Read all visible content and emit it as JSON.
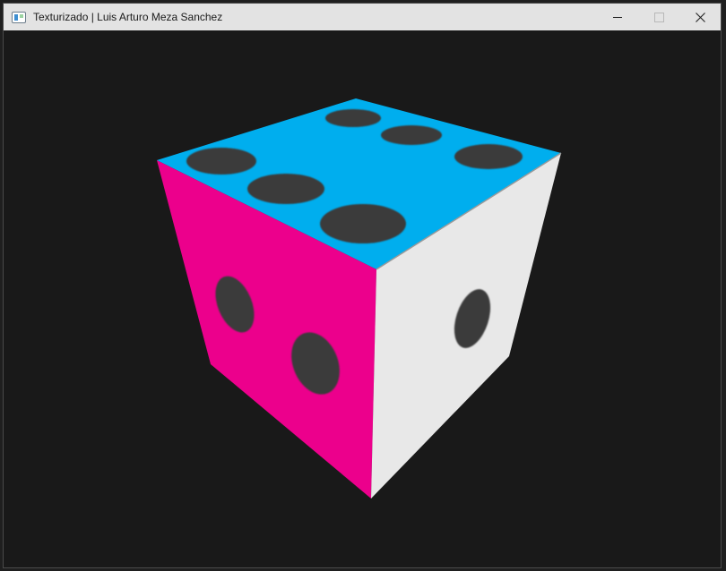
{
  "window": {
    "title": "Texturizado | Luis Arturo Meza Sanchez"
  },
  "scene": {
    "object": "dice cube",
    "top_face_pips": 6,
    "left_face_pips": 2,
    "right_face_pips": 1,
    "colors": {
      "top_face": "#00aeee",
      "left_face": "#ec008c",
      "right_face": "#e8e8e8",
      "pips": "#3a3a3a",
      "background": "#191919"
    }
  }
}
